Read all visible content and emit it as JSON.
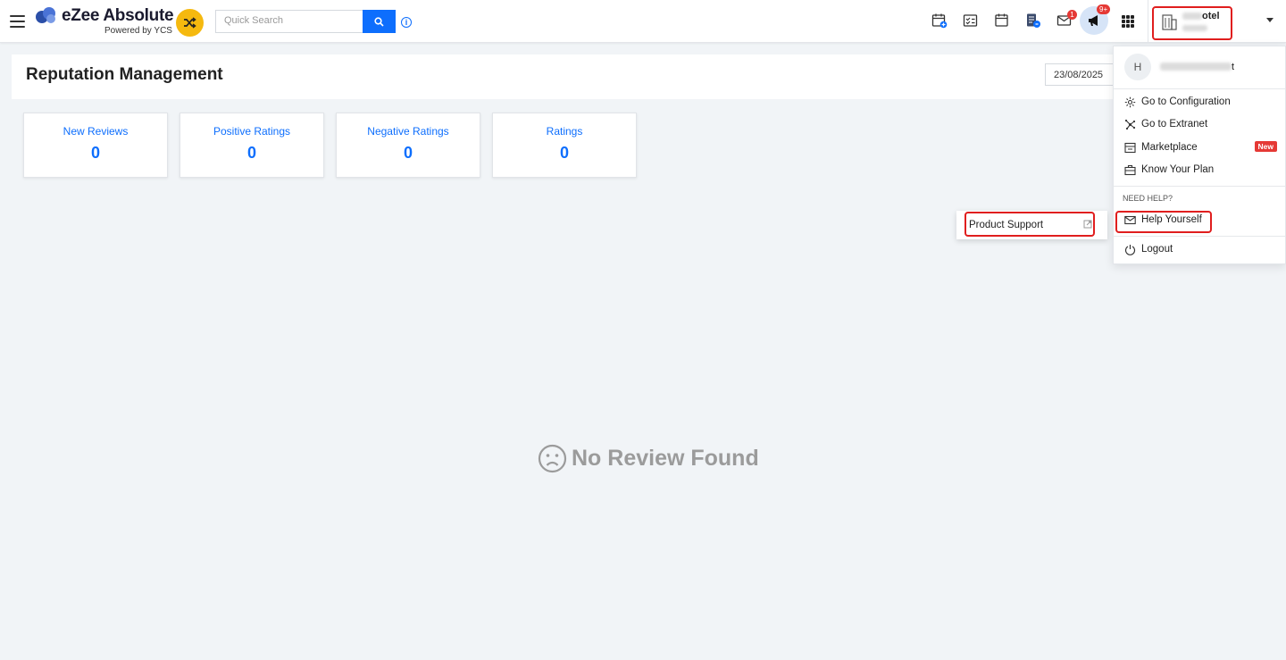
{
  "header": {
    "brand_title": "eZee Absolute",
    "brand_subtitle": "Powered by YCS",
    "search_placeholder": "Quick Search",
    "info_glyph": "i",
    "mail_badge": "1",
    "announcement_badge": "9+",
    "hotel_name_partial": "otel",
    "icons": [
      "menu-icon",
      "shuffle-icon",
      "search-icon",
      "info-icon",
      "calendar-add-icon",
      "checklist-icon",
      "calendar-icon",
      "report-icon",
      "mail-icon",
      "megaphone-icon",
      "apps-grid-icon",
      "hotel-building-icon",
      "caret-down-icon"
    ]
  },
  "page": {
    "title": "Reputation Management",
    "date": "23/08/2025"
  },
  "stats": [
    {
      "label": "New Reviews",
      "value": "0"
    },
    {
      "label": "Positive Ratings",
      "value": "0"
    },
    {
      "label": "Negative Ratings",
      "value": "0"
    },
    {
      "label": "Ratings",
      "value": "0"
    }
  ],
  "empty_state": {
    "text": "No Review Found",
    "icon": "sad-face-icon"
  },
  "submenu": {
    "product_support": "Product Support"
  },
  "user_menu": {
    "avatar_initial": "H",
    "username_suffix": "t",
    "items": [
      {
        "label": "Go to Configuration",
        "icon": "gear-icon"
      },
      {
        "label": "Go to Extranet",
        "icon": "network-icon"
      },
      {
        "label": "Marketplace",
        "icon": "store-icon"
      },
      {
        "label": "Know Your Plan",
        "icon": "briefcase-icon"
      }
    ],
    "new_badge": "New",
    "section_label": "NEED HELP?",
    "help_label": "Help Yourself",
    "logout_label": "Logout"
  },
  "colors": {
    "accent": "#0d6efd",
    "highlight_border": "#e01e1e",
    "brand_yellow": "#f5b90f",
    "badge_red": "#e53935"
  }
}
